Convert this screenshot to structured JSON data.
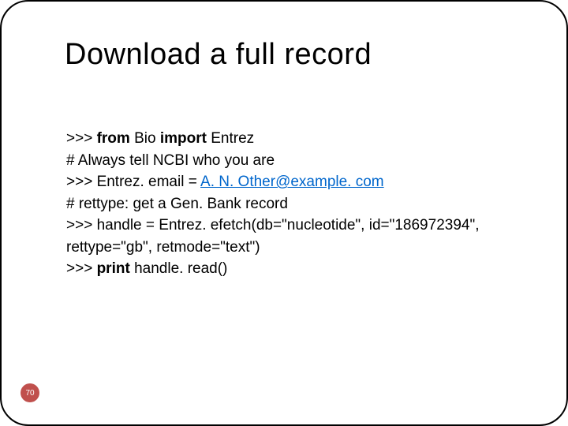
{
  "title": "Download a full record",
  "code": {
    "line1_prompt": ">>> ",
    "line1_kw1": "from",
    "line1_txt1": " Bio ",
    "line1_kw2": "import",
    "line1_txt2": " Entrez",
    "line2": "# Always tell NCBI who you are",
    "line3_prompt": ">>> Entrez. email = ",
    "line3_link": "A. N. Other@example. com",
    "line4": "# rettype: get a Gen. Bank record",
    "line5": ">>> handle = Entrez. efetch(db=\"nucleotide\", id=\"186972394\", rettype=\"gb\", retmode=\"text\")",
    "line6_prompt": ">>> ",
    "line6_kw": "print",
    "line6_txt": " handle. read()"
  },
  "page_number": "70"
}
